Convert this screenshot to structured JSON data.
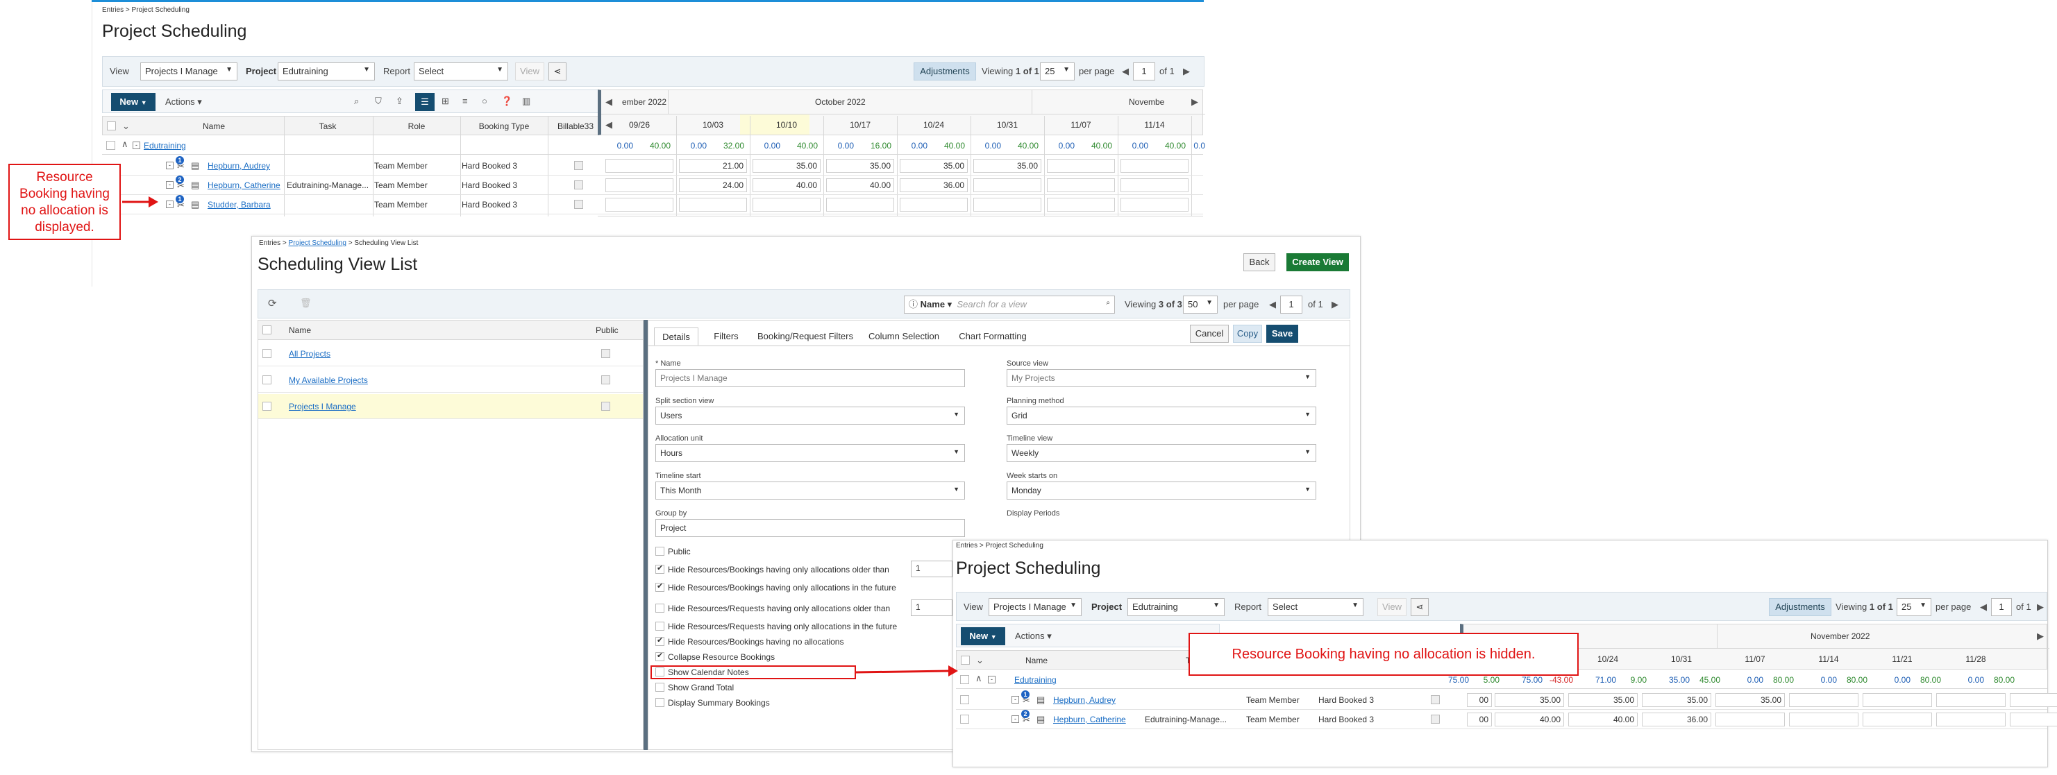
{
  "top_window": {
    "breadcrumb": "Entries > Project Scheduling",
    "title": "Project Scheduling",
    "filters": {
      "view_label": "View",
      "view_value": "Projects I Manage",
      "project_label": "Project",
      "project_value": "Edutraining",
      "report_label": "Report",
      "report_value": "Select",
      "view_button": "View"
    },
    "paging": {
      "adjustments": "Adjustments",
      "viewing_prefix": "Viewing",
      "viewing_value": "1 of 1",
      "per_page_value": "25",
      "per_page_label": "per page",
      "page_value": "1",
      "of_label": "of 1"
    },
    "toolbar": {
      "new": "New",
      "actions": "Actions"
    },
    "columns": [
      "Name",
      "Task",
      "Role",
      "Booking Type",
      "Billable33"
    ],
    "timeline": {
      "month_left": "ember 2022",
      "month_mid": "October 2022",
      "month_right": "Novembe",
      "weeks": [
        "09/26",
        "10/03",
        "10/10",
        "10/17",
        "10/24",
        "10/31",
        "11/07",
        "11/14"
      ]
    },
    "project": {
      "name": "Edutraining",
      "totals": [
        [
          "0.00",
          "40.00"
        ],
        [
          "0.00",
          "32.00"
        ],
        [
          "0.00",
          "40.00"
        ],
        [
          "0.00",
          "16.00"
        ],
        [
          "0.00",
          "40.00"
        ],
        [
          "0.00",
          "40.00"
        ],
        [
          "0.00",
          "40.00"
        ],
        [
          "0.00",
          "40.00"
        ]
      ],
      "totals_tail": "0.0"
    },
    "rows": [
      {
        "badge": "1",
        "name": "Hepburn, Audrey",
        "task": "",
        "role": "Team Member",
        "booking": "Hard Booked 3",
        "values": [
          "",
          "21.00",
          "35.00",
          "35.00",
          "35.00",
          "35.00",
          "",
          ""
        ]
      },
      {
        "badge": "2",
        "name": "Hepburn, Catherine",
        "task": "Edutraining-Manage...",
        "role": "Team Member",
        "booking": "Hard Booked 3",
        "values": [
          "",
          "24.00",
          "40.00",
          "40.00",
          "36.00",
          "",
          "",
          ""
        ]
      },
      {
        "badge": "1",
        "name": "Studder, Barbara",
        "task": "",
        "role": "Team Member",
        "booking": "Hard Booked 3",
        "values": [
          "",
          "",
          "",
          "",
          "",
          "",
          "",
          ""
        ]
      }
    ]
  },
  "callout_left": "Resource Booking having no allocation is displayed.",
  "middle_window": {
    "breadcrumb_1": "Entries >",
    "breadcrumb_link": "Project Scheduling",
    "breadcrumb_2": "> Scheduling View List",
    "title": "Scheduling View List",
    "back": "Back",
    "create_view": "Create View",
    "search_field": "Name",
    "search_placeholder": "Search for a view",
    "viewing_prefix": "Viewing",
    "viewing_value": "3 of 3",
    "per_page_value": "50",
    "per_page_label": "per page",
    "page_value": "1",
    "of_label": "of 1",
    "list_header": {
      "name": "Name",
      "public": "Public"
    },
    "views": [
      "All Projects",
      "My Available Projects",
      "Projects I Manage"
    ],
    "tabs": [
      "Details",
      "Filters",
      "Booking/Request Filters",
      "Column Selection",
      "Chart Formatting"
    ],
    "cancel": "Cancel",
    "copy": "Copy",
    "save": "Save",
    "fields": {
      "name_label": "* Name",
      "name_value": "Projects I Manage",
      "source_label": "Source view",
      "source_value": "My Projects",
      "split_label": "Split section view",
      "split_value": "Users",
      "planning_label": "Planning method",
      "planning_value": "Grid",
      "alloc_label": "Allocation unit",
      "alloc_value": "Hours",
      "timeline_label": "Timeline view",
      "timeline_value": "Weekly",
      "start_label": "Timeline start",
      "start_value": "This Month",
      "week_label": "Week starts on",
      "week_value": "Monday",
      "group_label": "Group by",
      "group_value": "Project",
      "display_label": "Display Periods"
    },
    "options": [
      {
        "label": "Public",
        "checked": false
      },
      {
        "label": "Hide Resources/Bookings having only allocations older than",
        "checked": true,
        "input": "1"
      },
      {
        "label": "Hide Resources/Bookings having only allocations in the future",
        "checked": true
      },
      {
        "label": "Hide Resources/Requests having only allocations older than",
        "checked": false,
        "input": "1"
      },
      {
        "label": "Hide Resources/Requests having only allocations in the future",
        "checked": false
      },
      {
        "label": "Hide Resources/Bookings having no allocations",
        "checked": true
      },
      {
        "label": "Collapse Resource Bookings",
        "checked": true
      },
      {
        "label": "Show Calendar Notes",
        "checked": false
      },
      {
        "label": "Show Grand Total",
        "checked": false
      },
      {
        "label": "Display Summary Bookings",
        "checked": false
      }
    ]
  },
  "bottom_window": {
    "breadcrumb": "Entries > Project Scheduling",
    "title": "Project Scheduling",
    "filters": {
      "view_label": "View",
      "view_value": "Projects I Manage",
      "project_label": "Project",
      "project_value": "Edutraining",
      "report_label": "Report",
      "report_value": "Select",
      "view_button": "View"
    },
    "paging": {
      "adjustments": "Adjustments",
      "viewing_prefix": "Viewing",
      "viewing_value": "1 of 1",
      "per_page_value": "25",
      "per_page_label": "per page",
      "page_value": "1",
      "of_label": "of 1"
    },
    "toolbar": {
      "new": "New",
      "actions": "Actions"
    },
    "columns": {
      "name": "Name",
      "task": "Ta"
    },
    "timeline": {
      "month_left": "2022",
      "month_right": "November 2022",
      "weeks": [
        "7",
        "10/24",
        "10/31",
        "11/07",
        "11/14",
        "11/21",
        "11/28"
      ]
    },
    "project": {
      "name": "Edutraining",
      "totals": [
        [
          "75.00",
          "5.00"
        ],
        [
          "75.00",
          "-43.00"
        ],
        [
          "71.00",
          "9.00"
        ],
        [
          "35.00",
          "45.00"
        ],
        [
          "0.00",
          "80.00"
        ],
        [
          "0.00",
          "80.00"
        ],
        [
          "0.00",
          "80.00"
        ],
        [
          "0.00",
          "80.00"
        ]
      ]
    },
    "rows": [
      {
        "badge": "1",
        "name": "Hepburn, Audrey",
        "task": "",
        "role": "Team Member",
        "booking": "Hard Booked 3",
        "values": [
          "00",
          "35.00",
          "35.00",
          "35.00",
          "35.00",
          "",
          "",
          "",
          ""
        ]
      },
      {
        "badge": "2",
        "name": "Hepburn, Catherine",
        "task": "Edutraining-Manage...",
        "role": "Team Member",
        "booking": "Hard Booked 3",
        "values": [
          "00",
          "40.00",
          "40.00",
          "36.00",
          "",
          "",
          "",
          "",
          ""
        ]
      }
    ]
  },
  "callout_right": "Resource Booking having no allocation is hidden.",
  "colors": {
    "accent": "#1d8ed8",
    "dark_button": "#154d70",
    "green_button": "#1a7a35",
    "callout": "#e01414",
    "highlight_week": "#fdfbd8",
    "selected_row": "#fdfbd8"
  }
}
